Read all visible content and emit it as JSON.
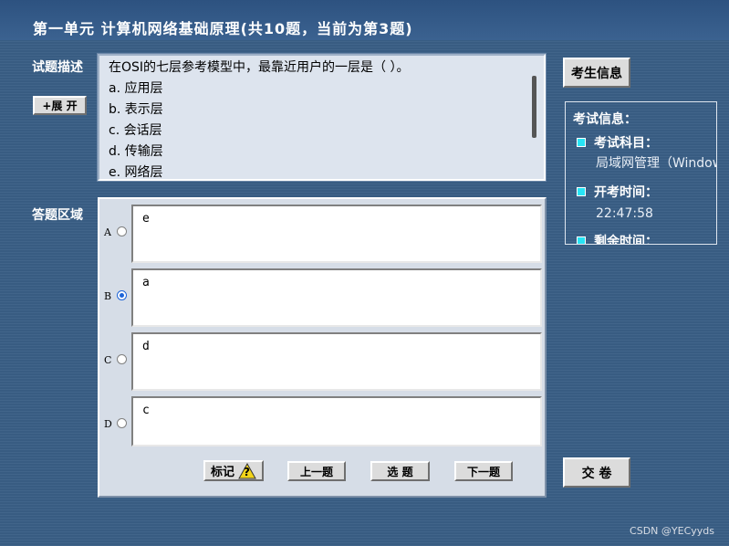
{
  "header": {
    "title": "第一单元    计算机网络基础原理(共10题，当前为第3题)"
  },
  "question": {
    "label": "试题描述",
    "expand_button": "+展 开",
    "stem": "在OSI的七层参考模型中，最靠近用户的一层是（     ）。",
    "choices": [
      "a. 应用层",
      "b. 表示层",
      "c. 会话层",
      "d. 传输层",
      "e. 网络层"
    ]
  },
  "answer": {
    "label": "答题区域",
    "options": [
      {
        "letter": "A",
        "text": "e",
        "selected": false
      },
      {
        "letter": "B",
        "text": "a",
        "selected": true
      },
      {
        "letter": "C",
        "text": "d",
        "selected": false
      },
      {
        "letter": "D",
        "text": "c",
        "selected": false
      }
    ],
    "buttons": {
      "mark": "标记",
      "mark_icon": "?",
      "prev": "上一题",
      "select": "选 题",
      "next": "下一题"
    }
  },
  "sidebar": {
    "student_info_button": "考生信息",
    "exam_info_title": "考试信息：",
    "subject_label": "考试科目：",
    "subject_value": "局域网管理（Windows",
    "start_label": "开考时间：",
    "start_value": "22:47:58",
    "remaining_label": "剩余时间："
  },
  "submit_button": "交  卷",
  "watermark": "CSDN @YECyyds",
  "colors": {
    "background": "#3a5f86",
    "radio_selected": "#1d64d8",
    "info_bullet": "#27e4f5"
  }
}
